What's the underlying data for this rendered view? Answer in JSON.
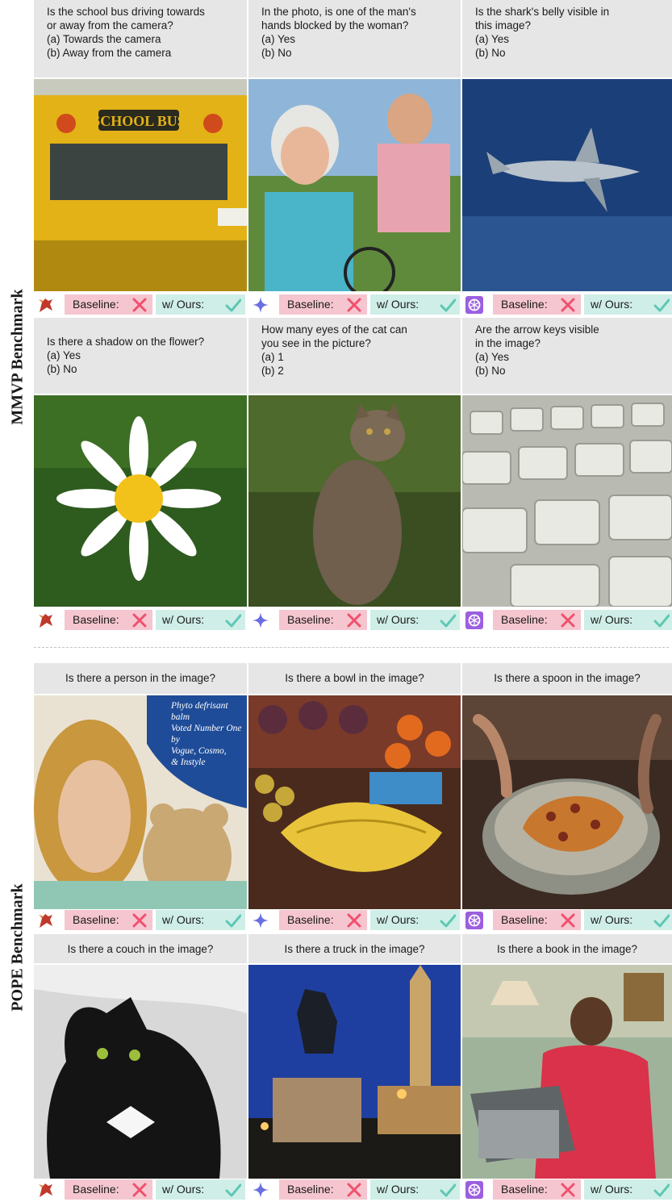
{
  "sections": [
    {
      "label": "MMVP Benchmark"
    },
    {
      "label": "POPE Benchmark"
    }
  ],
  "mmvp_row1": [
    {
      "question": "Is the school bus driving towards\nor away from the camera?\n(a) Towards the camera\n(b) Away from the camera",
      "model_icon": "dragon-logo-icon"
    },
    {
      "question": "In the photo, is one of the man's\nhands blocked by the woman?\n(a) Yes\n(b) No",
      "model_icon": "gemini-sparkle-icon"
    },
    {
      "question": "Is the shark's belly visible in\nthis image?\n(a) Yes\n(b) No",
      "model_icon": "openai-logo-icon"
    }
  ],
  "mmvp_row2": [
    {
      "question": "Is there a shadow on the flower?\n(a) Yes\n(b) No",
      "model_icon": "dragon-logo-icon"
    },
    {
      "question": "How many eyes of the cat can\nyou see in the picture?\n(a) 1\n(b) 2",
      "model_icon": "gemini-sparkle-icon"
    },
    {
      "question": "Are the arrow keys visible\nin the image?\n(a) Yes\n(b) No",
      "model_icon": "openai-logo-icon"
    }
  ],
  "pope_row1": [
    {
      "question": "Is there a person in the image?",
      "model_icon": "dragon-logo-icon",
      "poster_text": "Phyto defrisant balm\nVoted Number One by\nVogue, Cosmo,\n& Instyle"
    },
    {
      "question": "Is there a bowl in the image?",
      "model_icon": "gemini-sparkle-icon"
    },
    {
      "question": "Is there a spoon in the image?",
      "model_icon": "openai-logo-icon"
    }
  ],
  "pope_row2": [
    {
      "question": "Is there a couch in the image?",
      "model_icon": "dragon-logo-icon"
    },
    {
      "question": "Is there a truck in the image?",
      "model_icon": "gemini-sparkle-icon"
    },
    {
      "question": "Is there a book in the image?",
      "model_icon": "openai-logo-icon"
    }
  ],
  "result": {
    "baseline_label": "Baseline:",
    "ours_label": "w/ Ours:",
    "baseline_mark": "cross-icon",
    "ours_mark": "check-icon"
  },
  "colors": {
    "question_bg": "#e6e6e6",
    "baseline_bg": "#f5c6cf",
    "ours_bg": "#cfeee7",
    "cross": "#f0506e",
    "check": "#5ec8b4",
    "gemini": "#6a6fe0",
    "openai": "#9b5fe0",
    "dragon": "#c0392b"
  }
}
